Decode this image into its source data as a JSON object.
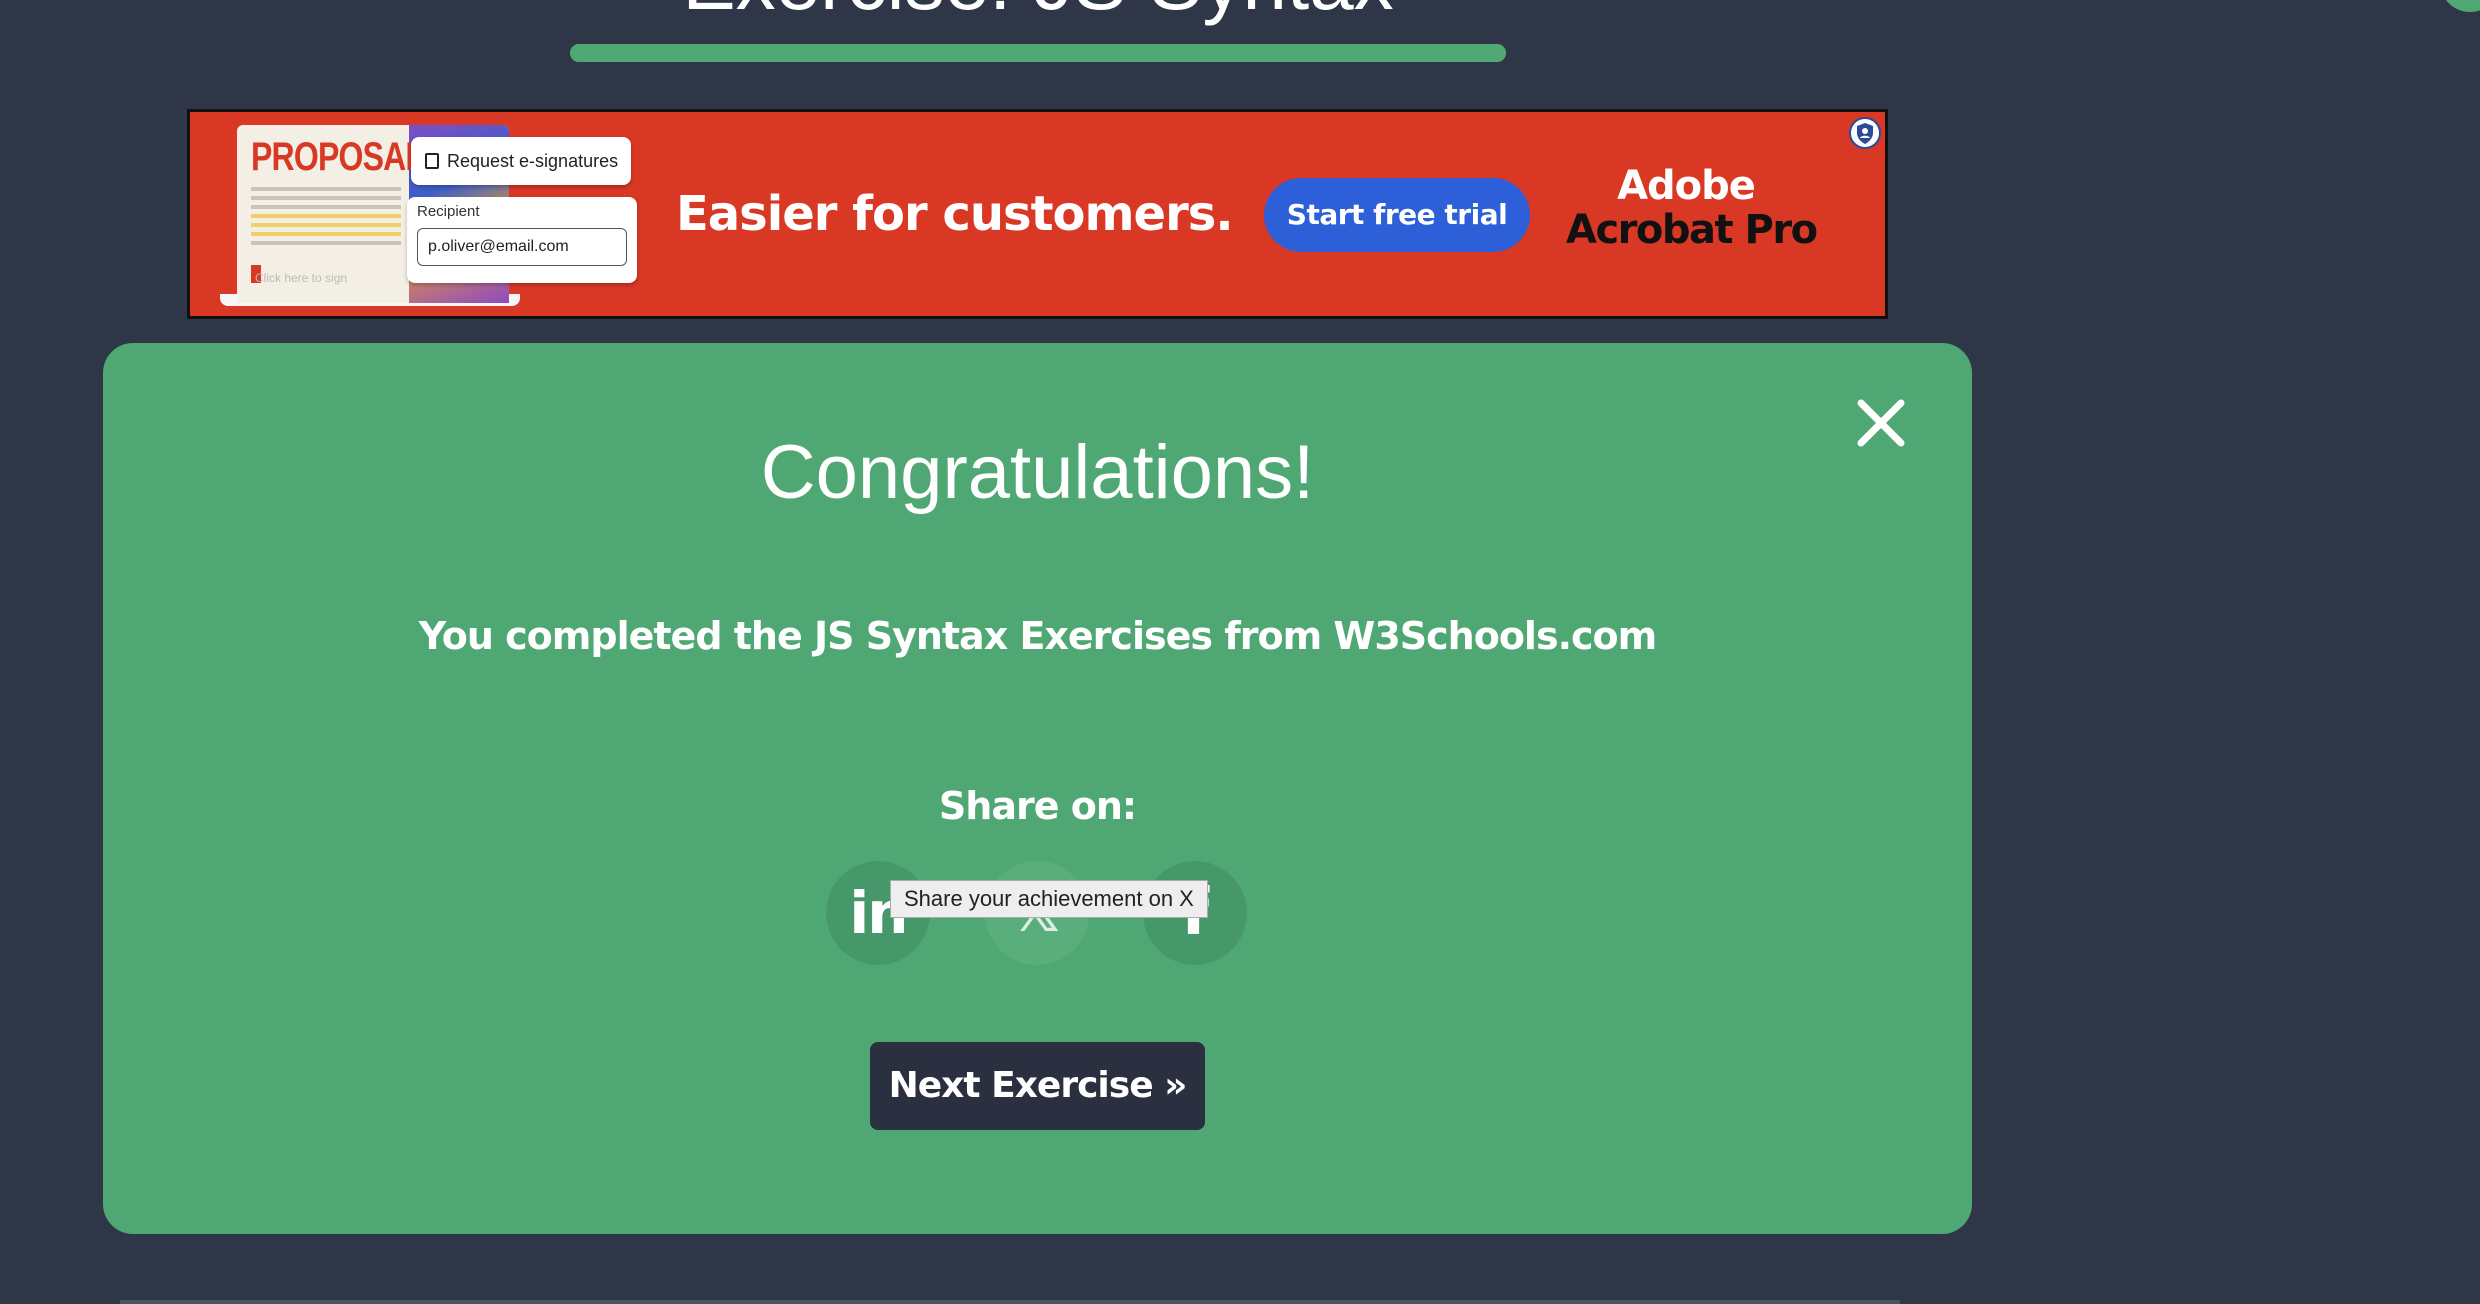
{
  "page": {
    "heading": "Exercise: JS Syntax",
    "progress_percent": 100
  },
  "ad": {
    "doc_title": "PROPOSAL",
    "chip_label": "Request e-signatures",
    "recipient_label": "Recipient",
    "recipient_email": "p.oliver@email.com",
    "sign_hint": "Click here to sign",
    "headline": "Easier for customers.",
    "cta_label": "Start free trial",
    "brand_line1": "Adobe",
    "brand_line2": "Acrobat Pro",
    "badge_icon": "ad-choices-icon",
    "bg_color": "#d93825",
    "cta_color": "#2c5fd8"
  },
  "modal": {
    "title": "Congratulations!",
    "message": "You completed the JS Syntax Exercises from W3Schools.com",
    "share_label": "Share on:",
    "share_buttons": [
      {
        "icon": "linkedin-icon",
        "glyph": "in"
      },
      {
        "icon": "x-icon",
        "glyph": "𝕏"
      },
      {
        "icon": "facebook-icon",
        "glyph": "f"
      }
    ],
    "tooltip": "Share your achievement on X",
    "next_button": "Next Exercise »",
    "close_icon": "close-icon",
    "bg_color": "#4fa873"
  },
  "colors": {
    "page_bg": "#2f3647",
    "accent_green": "#4fa873",
    "button_dark": "#2a3040"
  }
}
